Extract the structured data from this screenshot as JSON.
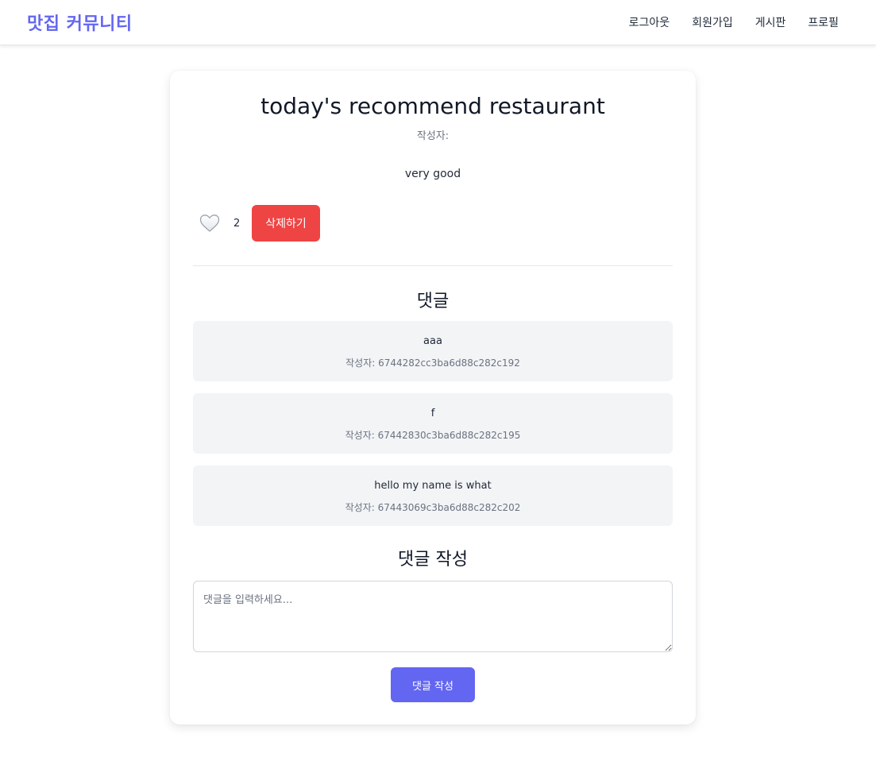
{
  "nav": {
    "brand": "맛집 커뮤니티",
    "links": [
      "로그아웃",
      "회원가입",
      "게시판",
      "프로필"
    ]
  },
  "post": {
    "title": "today's recommend restaurant",
    "author_line": "작성자:",
    "content": "very good",
    "like_icon": "heart-outline-icon",
    "like_count": "2",
    "delete_label": "삭제하기"
  },
  "comments_section": {
    "title": "댓글",
    "items": [
      {
        "text": "aaa",
        "author": "작성자: 6744282cc3ba6d88c282c192"
      },
      {
        "text": "f",
        "author": "작성자: 67442830c3ba6d88c282c195"
      },
      {
        "text": "hello my name is what",
        "author": "작성자: 67443069c3ba6d88c282c202"
      }
    ]
  },
  "comment_form": {
    "title": "댓글 작성",
    "placeholder": "댓글을 입력하세요...",
    "value": "",
    "submit_label": "댓글 작성"
  },
  "colors": {
    "brand": "#6366f1",
    "delete": "#ef4444",
    "comment_bg": "#f3f4f6"
  }
}
